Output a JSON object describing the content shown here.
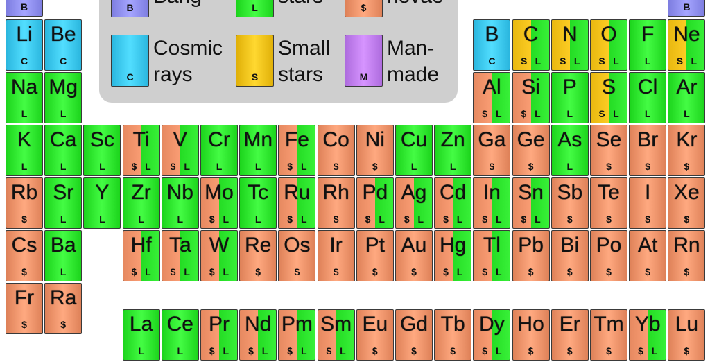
{
  "colors": {
    "big_bang": "#8f8ff2",
    "cosmic_rays": "#3cc8f0",
    "small_stars": "#f2c21a",
    "large_stars": "#2ee62e",
    "supernovae": "#f0936a",
    "man_made": "#c07ef0"
  },
  "legend": {
    "items": [
      {
        "key": "big_bang",
        "code": "B",
        "text": "Bang"
      },
      {
        "key": "large_stars",
        "code": "L",
        "text": "stars"
      },
      {
        "key": "supernovae",
        "code": "$",
        "text": "novae"
      },
      {
        "key": "cosmic_rays",
        "code": "C",
        "text_lines": [
          "Cosmic",
          "rays"
        ]
      },
      {
        "key": "small_stars",
        "code": "S",
        "text_lines": [
          "Small",
          "stars"
        ]
      },
      {
        "key": "man_made",
        "code": "M",
        "text_lines": [
          "Man-",
          "made"
        ]
      }
    ]
  },
  "elements": [
    {
      "symbol": "",
      "row": -1,
      "col": 0,
      "origins": [
        "B"
      ]
    },
    {
      "symbol": "",
      "row": -1,
      "col": 17,
      "origins": [
        "B"
      ]
    },
    {
      "symbol": "Li",
      "row": 0,
      "col": 0,
      "origins": [
        "C"
      ]
    },
    {
      "symbol": "Be",
      "row": 0,
      "col": 1,
      "origins": [
        "C"
      ]
    },
    {
      "symbol": "B",
      "row": 0,
      "col": 12,
      "origins": [
        "C"
      ]
    },
    {
      "symbol": "C",
      "row": 0,
      "col": 13,
      "origins": [
        "S",
        "L"
      ]
    },
    {
      "symbol": "N",
      "row": 0,
      "col": 14,
      "origins": [
        "S",
        "L"
      ]
    },
    {
      "symbol": "O",
      "row": 0,
      "col": 15,
      "origins": [
        "S",
        "L"
      ]
    },
    {
      "symbol": "F",
      "row": 0,
      "col": 16,
      "origins": [
        "L"
      ]
    },
    {
      "symbol": "Ne",
      "row": 0,
      "col": 17,
      "origins": [
        "S",
        "L"
      ]
    },
    {
      "symbol": "Na",
      "row": 1,
      "col": 0,
      "origins": [
        "L"
      ]
    },
    {
      "symbol": "Mg",
      "row": 1,
      "col": 1,
      "origins": [
        "L"
      ]
    },
    {
      "symbol": "Al",
      "row": 1,
      "col": 12,
      "origins": [
        "$",
        "L"
      ]
    },
    {
      "symbol": "Si",
      "row": 1,
      "col": 13,
      "origins": [
        "$",
        "L"
      ]
    },
    {
      "symbol": "P",
      "row": 1,
      "col": 14,
      "origins": [
        "L"
      ]
    },
    {
      "symbol": "S",
      "row": 1,
      "col": 15,
      "origins": [
        "S",
        "L"
      ]
    },
    {
      "symbol": "Cl",
      "row": 1,
      "col": 16,
      "origins": [
        "L"
      ]
    },
    {
      "symbol": "Ar",
      "row": 1,
      "col": 17,
      "origins": [
        "L"
      ]
    },
    {
      "symbol": "K",
      "row": 2,
      "col": 0,
      "origins": [
        "L"
      ]
    },
    {
      "symbol": "Ca",
      "row": 2,
      "col": 1,
      "origins": [
        "L"
      ]
    },
    {
      "symbol": "Sc",
      "row": 2,
      "col": 2,
      "origins": [
        "L"
      ]
    },
    {
      "symbol": "Ti",
      "row": 2,
      "col": 3,
      "origins": [
        "$",
        "L"
      ]
    },
    {
      "symbol": "V",
      "row": 2,
      "col": 4,
      "origins": [
        "$",
        "L"
      ]
    },
    {
      "symbol": "Cr",
      "row": 2,
      "col": 5,
      "origins": [
        "L"
      ]
    },
    {
      "symbol": "Mn",
      "row": 2,
      "col": 6,
      "origins": [
        "L"
      ]
    },
    {
      "symbol": "Fe",
      "row": 2,
      "col": 7,
      "origins": [
        "$",
        "L"
      ]
    },
    {
      "symbol": "Co",
      "row": 2,
      "col": 8,
      "origins": [
        "$"
      ]
    },
    {
      "symbol": "Ni",
      "row": 2,
      "col": 9,
      "origins": [
        "$"
      ]
    },
    {
      "symbol": "Cu",
      "row": 2,
      "col": 10,
      "origins": [
        "L"
      ]
    },
    {
      "symbol": "Zn",
      "row": 2,
      "col": 11,
      "origins": [
        "L"
      ]
    },
    {
      "symbol": "Ga",
      "row": 2,
      "col": 12,
      "origins": [
        "$"
      ]
    },
    {
      "symbol": "Ge",
      "row": 2,
      "col": 13,
      "origins": [
        "$"
      ]
    },
    {
      "symbol": "As",
      "row": 2,
      "col": 14,
      "origins": [
        "L"
      ]
    },
    {
      "symbol": "Se",
      "row": 2,
      "col": 15,
      "origins": [
        "$"
      ]
    },
    {
      "symbol": "Br",
      "row": 2,
      "col": 16,
      "origins": [
        "$"
      ]
    },
    {
      "symbol": "Kr",
      "row": 2,
      "col": 17,
      "origins": [
        "$"
      ]
    },
    {
      "symbol": "Rb",
      "row": 3,
      "col": 0,
      "origins": [
        "$"
      ]
    },
    {
      "symbol": "Sr",
      "row": 3,
      "col": 1,
      "origins": [
        "L"
      ]
    },
    {
      "symbol": "Y",
      "row": 3,
      "col": 2,
      "origins": [
        "L"
      ]
    },
    {
      "symbol": "Zr",
      "row": 3,
      "col": 3,
      "origins": [
        "L"
      ]
    },
    {
      "symbol": "Nb",
      "row": 3,
      "col": 4,
      "origins": [
        "L"
      ]
    },
    {
      "symbol": "Mo",
      "row": 3,
      "col": 5,
      "origins": [
        "$",
        "L"
      ]
    },
    {
      "symbol": "Tc",
      "row": 3,
      "col": 6,
      "origins": [
        "L"
      ]
    },
    {
      "symbol": "Ru",
      "row": 3,
      "col": 7,
      "origins": [
        "$",
        "L"
      ]
    },
    {
      "symbol": "Rh",
      "row": 3,
      "col": 8,
      "origins": [
        "$"
      ]
    },
    {
      "symbol": "Pd",
      "row": 3,
      "col": 9,
      "origins": [
        "$",
        "L"
      ]
    },
    {
      "symbol": "Ag",
      "row": 3,
      "col": 10,
      "origins": [
        "$",
        "L"
      ]
    },
    {
      "symbol": "Cd",
      "row": 3,
      "col": 11,
      "origins": [
        "$",
        "L"
      ]
    },
    {
      "symbol": "In",
      "row": 3,
      "col": 12,
      "origins": [
        "$",
        "L"
      ]
    },
    {
      "symbol": "Sn",
      "row": 3,
      "col": 13,
      "origins": [
        "$",
        "L"
      ]
    },
    {
      "symbol": "Sb",
      "row": 3,
      "col": 14,
      "origins": [
        "$"
      ]
    },
    {
      "symbol": "Te",
      "row": 3,
      "col": 15,
      "origins": [
        "$"
      ]
    },
    {
      "symbol": "I",
      "row": 3,
      "col": 16,
      "origins": [
        "$"
      ]
    },
    {
      "symbol": "Xe",
      "row": 3,
      "col": 17,
      "origins": [
        "$"
      ]
    },
    {
      "symbol": "Cs",
      "row": 4,
      "col": 0,
      "origins": [
        "$"
      ]
    },
    {
      "symbol": "Ba",
      "row": 4,
      "col": 1,
      "origins": [
        "L"
      ]
    },
    {
      "symbol": "Hf",
      "row": 4,
      "col": 3,
      "origins": [
        "$",
        "L"
      ]
    },
    {
      "symbol": "Ta",
      "row": 4,
      "col": 4,
      "origins": [
        "$",
        "L"
      ]
    },
    {
      "symbol": "W",
      "row": 4,
      "col": 5,
      "origins": [
        "$",
        "L"
      ]
    },
    {
      "symbol": "Re",
      "row": 4,
      "col": 6,
      "origins": [
        "$"
      ]
    },
    {
      "symbol": "Os",
      "row": 4,
      "col": 7,
      "origins": [
        "$"
      ]
    },
    {
      "symbol": "Ir",
      "row": 4,
      "col": 8,
      "origins": [
        "$"
      ]
    },
    {
      "symbol": "Pt",
      "row": 4,
      "col": 9,
      "origins": [
        "$"
      ]
    },
    {
      "symbol": "Au",
      "row": 4,
      "col": 10,
      "origins": [
        "$"
      ]
    },
    {
      "symbol": "Hg",
      "row": 4,
      "col": 11,
      "origins": [
        "$",
        "L"
      ]
    },
    {
      "symbol": "Tl",
      "row": 4,
      "col": 12,
      "origins": [
        "$",
        "L"
      ]
    },
    {
      "symbol": "Pb",
      "row": 4,
      "col": 13,
      "origins": [
        "$"
      ]
    },
    {
      "symbol": "Bi",
      "row": 4,
      "col": 14,
      "origins": [
        "$"
      ]
    },
    {
      "symbol": "Po",
      "row": 4,
      "col": 15,
      "origins": [
        "$"
      ]
    },
    {
      "symbol": "At",
      "row": 4,
      "col": 16,
      "origins": [
        "$"
      ]
    },
    {
      "symbol": "Rn",
      "row": 4,
      "col": 17,
      "origins": [
        "$"
      ]
    },
    {
      "symbol": "Fr",
      "row": 5,
      "col": 0,
      "origins": [
        "$"
      ]
    },
    {
      "symbol": "Ra",
      "row": 5,
      "col": 1,
      "origins": [
        "$"
      ]
    },
    {
      "symbol": "La",
      "row": 6,
      "col": 3,
      "origins": [
        "L"
      ]
    },
    {
      "symbol": "Ce",
      "row": 6,
      "col": 4,
      "origins": [
        "L"
      ]
    },
    {
      "symbol": "Pr",
      "row": 6,
      "col": 5,
      "origins": [
        "$",
        "L"
      ]
    },
    {
      "symbol": "Nd",
      "row": 6,
      "col": 6,
      "origins": [
        "$",
        "L"
      ]
    },
    {
      "symbol": "Pm",
      "row": 6,
      "col": 7,
      "origins": [
        "$",
        "L"
      ]
    },
    {
      "symbol": "Sm",
      "row": 6,
      "col": 8,
      "origins": [
        "$",
        "L"
      ]
    },
    {
      "symbol": "Eu",
      "row": 6,
      "col": 9,
      "origins": [
        "$"
      ]
    },
    {
      "symbol": "Gd",
      "row": 6,
      "col": 10,
      "origins": [
        "$"
      ]
    },
    {
      "symbol": "Tb",
      "row": 6,
      "col": 11,
      "origins": [
        "$"
      ]
    },
    {
      "symbol": "Dy",
      "row": 6,
      "col": 12,
      "origins": [
        "$",
        "L"
      ]
    },
    {
      "symbol": "Ho",
      "row": 6,
      "col": 13,
      "origins": [
        "$"
      ]
    },
    {
      "symbol": "Er",
      "row": 6,
      "col": 14,
      "origins": [
        "$"
      ]
    },
    {
      "symbol": "Tm",
      "row": 6,
      "col": 15,
      "origins": [
        "$"
      ]
    },
    {
      "symbol": "Yb",
      "row": 6,
      "col": 16,
      "origins": [
        "$",
        "L"
      ]
    },
    {
      "symbol": "Lu",
      "row": 6,
      "col": 17,
      "origins": [
        "$"
      ]
    }
  ]
}
